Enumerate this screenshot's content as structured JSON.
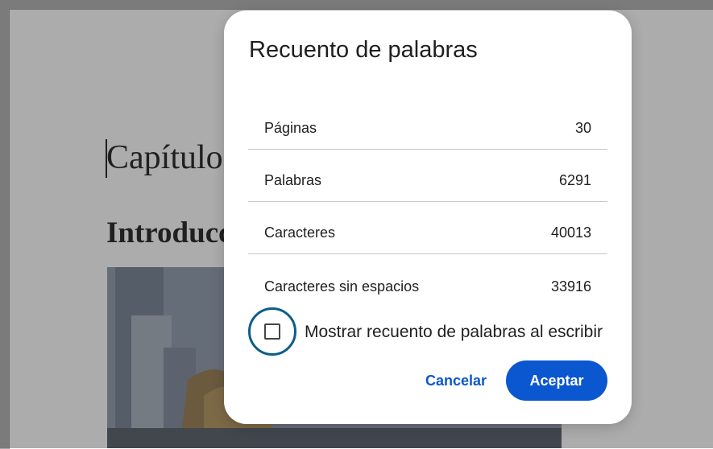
{
  "document": {
    "heading": "Capítulo",
    "subheading": "Introducc"
  },
  "dialog": {
    "title": "Recuento de palabras",
    "stats": [
      {
        "label": "Páginas",
        "value": "30"
      },
      {
        "label": "Palabras",
        "value": "6291"
      },
      {
        "label": "Caracteres",
        "value": "40013"
      },
      {
        "label": "Caracteres sin espacios",
        "value": "33916"
      }
    ],
    "checkbox": {
      "label": "Mostrar recuento de palabras al escribir",
      "checked": false
    },
    "buttons": {
      "cancel": "Cancelar",
      "ok": "Aceptar"
    }
  },
  "colors": {
    "primary": "#0b57d0",
    "focus_ring": "#0b5e8a",
    "scrim": "#a6a6a8"
  }
}
